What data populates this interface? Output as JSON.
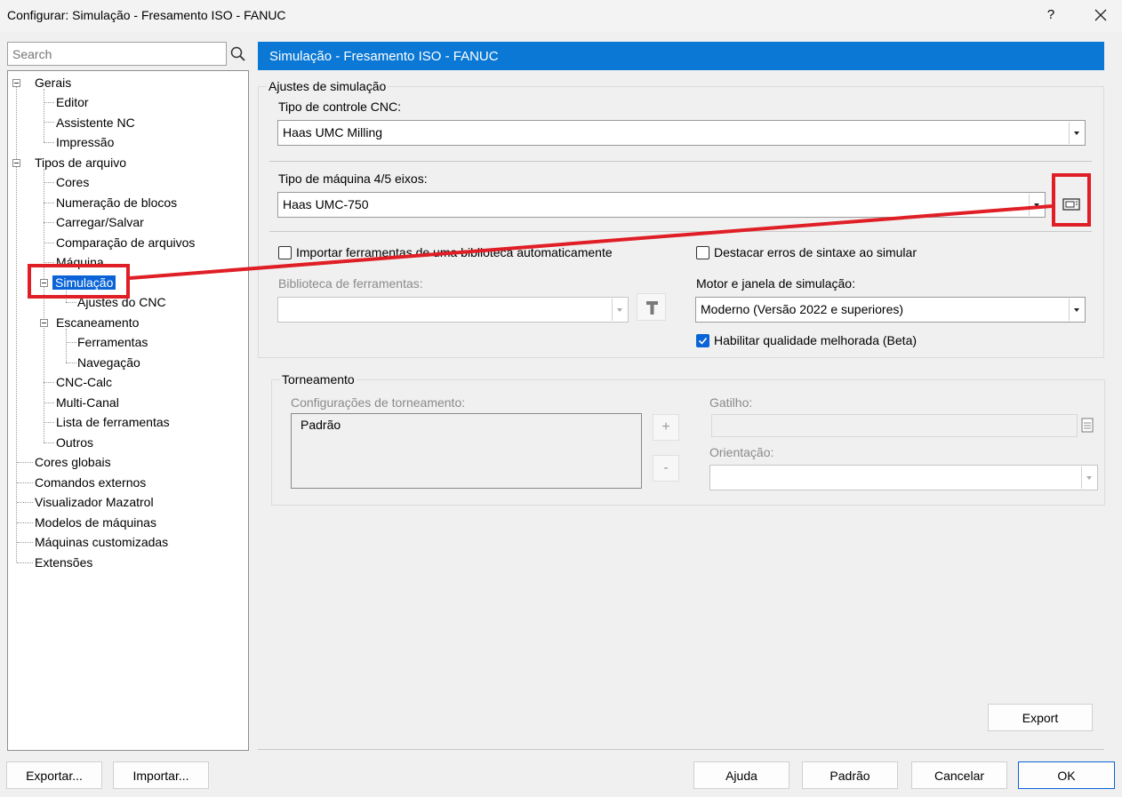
{
  "window": {
    "title": "Configurar: Simulação - Fresamento ISO - FANUC",
    "help": "?",
    "close": "✕"
  },
  "search": {
    "placeholder": "Search"
  },
  "tree": {
    "gerais": "Gerais",
    "editor": "Editor",
    "assistente": "Assistente NC",
    "impressao": "Impressão",
    "tipos": "Tipos de arquivo",
    "cores": "Cores",
    "numeracao": "Numeração de blocos",
    "carregar": "Carregar/Salvar",
    "comparacao": "Comparação de arquivos",
    "maquina": "Máquina",
    "simulacao": "Simulação",
    "ajustes_cnc": "Ajustes do CNC",
    "escaneamento": "Escaneamento",
    "ferramentas": "Ferramentas",
    "navegacao": "Navegação",
    "cnc_calc": "CNC-Calc",
    "multi_canal": "Multi-Canal",
    "lista_ferramentas": "Lista de ferramentas",
    "outros": "Outros",
    "cores_globais": "Cores globais",
    "comandos": "Comandos externos",
    "mazatrol": "Visualizador Mazatrol",
    "modelos": "Modelos de máquinas",
    "customizadas": "Máquinas customizadas",
    "extensoes": "Extensões"
  },
  "panel": {
    "header": "Simulação - Fresamento ISO - FANUC",
    "ajustes_group": "Ajustes de simulação",
    "tipo_controle_label": "Tipo de controle CNC:",
    "tipo_controle_value": "Haas UMC Milling",
    "tipo_maquina_label": "Tipo de máquina 4/5 eixos:",
    "tipo_maquina_value": "Haas UMC-750",
    "importar_label": "Importar ferramentas de uma biblioteca automaticamente",
    "destacar_label": "Destacar erros de sintaxe ao simular",
    "biblioteca_label": "Biblioteca de ferramentas:",
    "motor_label": "Motor e janela de simulação:",
    "motor_value": "Moderno (Versão 2022 e superiores)",
    "habilitar_label": "Habilitar qualidade melhorada (Beta)",
    "torneamento_group": "Torneamento",
    "config_torn_label": "Configurações de torneamento:",
    "config_torn_item": "Padrão",
    "plus": "+",
    "minus": "-",
    "gatilho_label": "Gatilho:",
    "orientacao_label": "Orientação:",
    "export_btn": "Export"
  },
  "footer": {
    "exportar": "Exportar...",
    "importar": "Importar...",
    "ajuda": "Ajuda",
    "padrao": "Padrão",
    "cancelar": "Cancelar",
    "ok": "OK"
  },
  "colors": {
    "accent": "#0a78d4",
    "selection": "#0a64d7",
    "highlight": "#e01e26"
  }
}
